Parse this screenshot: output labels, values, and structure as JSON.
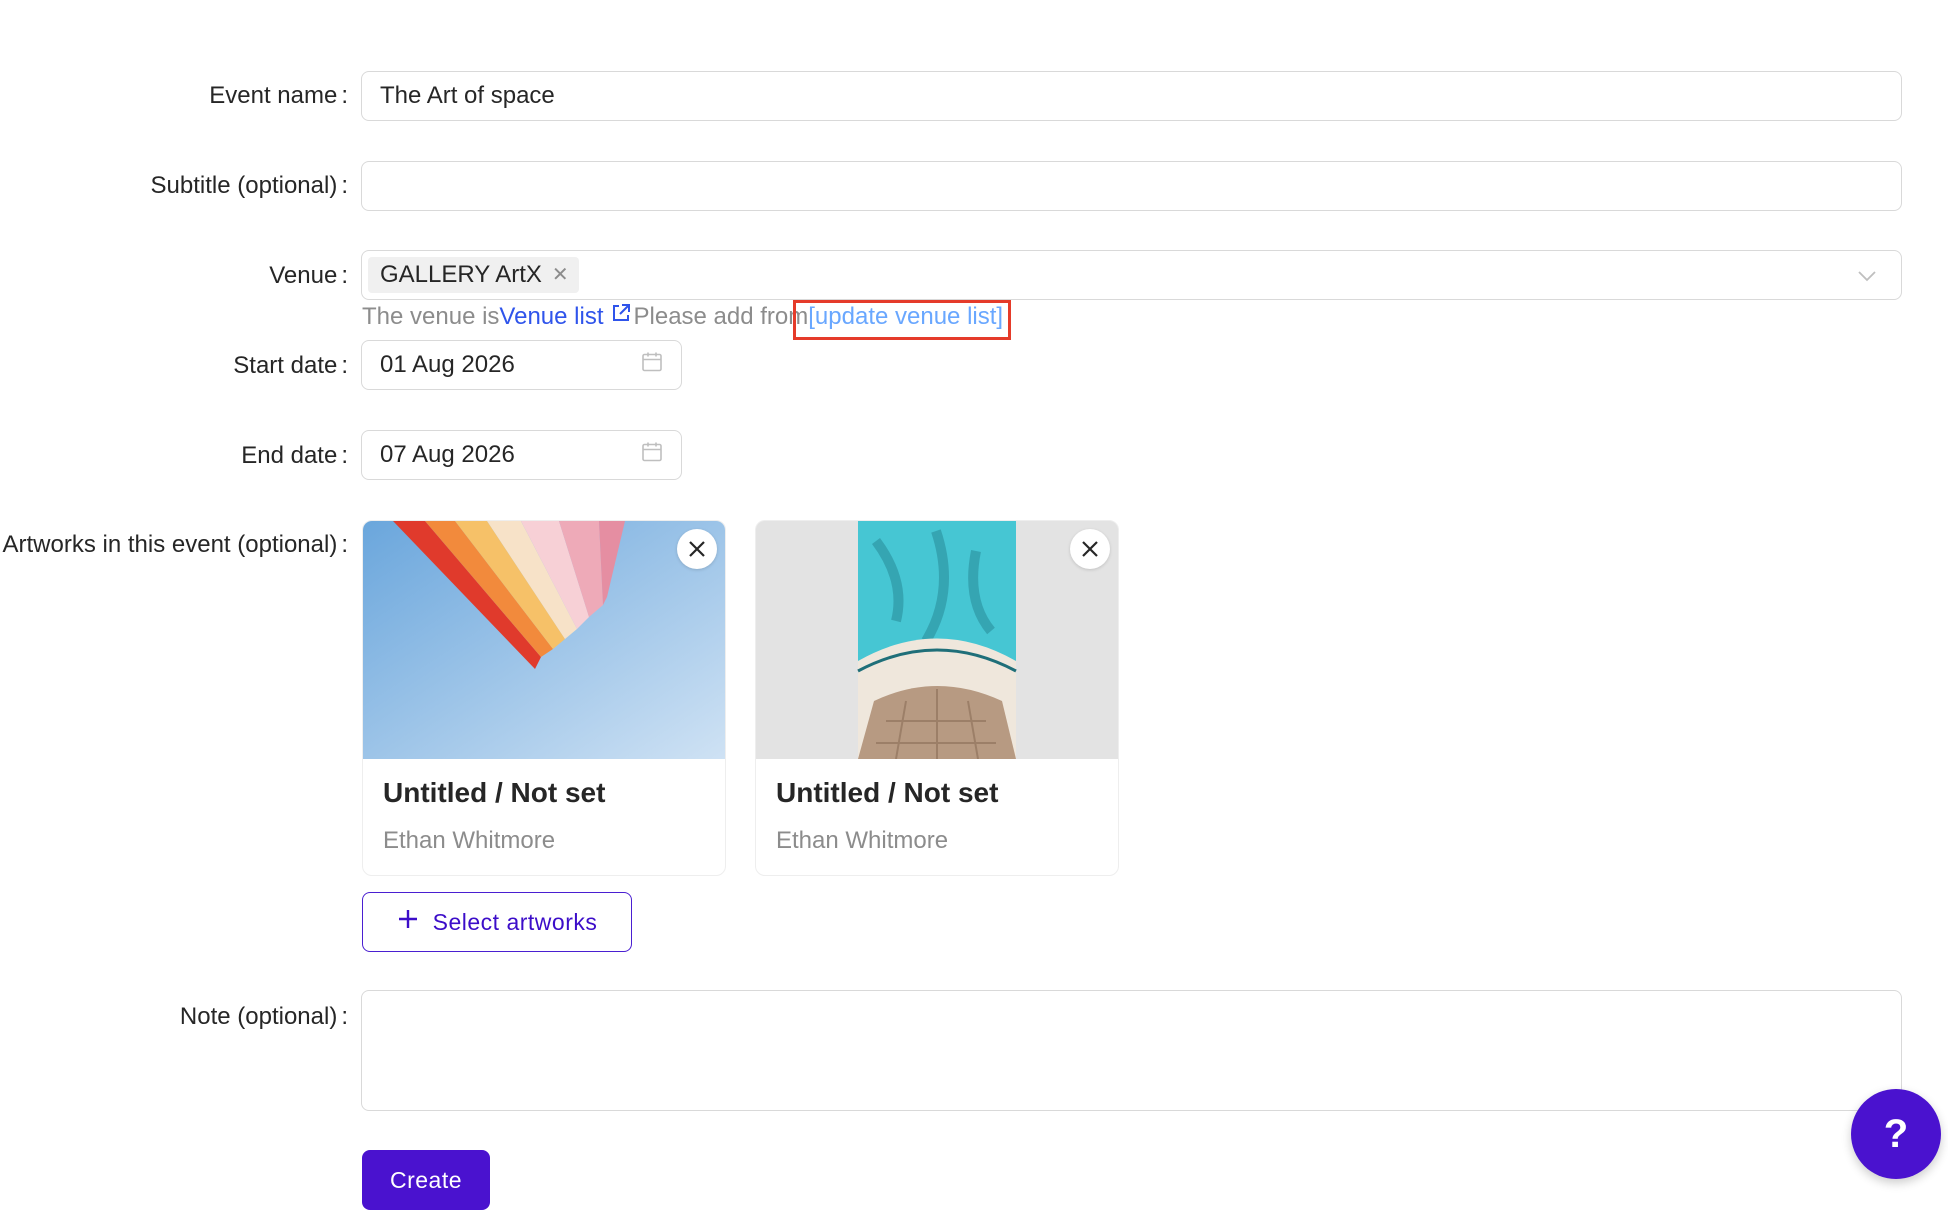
{
  "form": {
    "event_name": {
      "label": "Event name",
      "value": "The Art of space"
    },
    "subtitle": {
      "label": "Subtitle (optional)",
      "value": ""
    },
    "venue": {
      "label": "Venue",
      "selected_tag": "GALLERY ArtX",
      "help_prefix": "The venue is",
      "help_link": "Venue list",
      "help_middle": "Please add from",
      "help_update": "[update venue list]"
    },
    "start_date": {
      "label": "Start date",
      "value": "01 Aug 2026"
    },
    "end_date": {
      "label": "End date",
      "value": "07 Aug 2026"
    },
    "artworks": {
      "label": "Artworks in this event (optional)",
      "items": [
        {
          "title": "Untitled / Not set",
          "artist": "Ethan Whitmore"
        },
        {
          "title": "Untitled / Not set",
          "artist": "Ethan Whitmore"
        }
      ],
      "select_button": "Select artworks"
    },
    "note": {
      "label": "Note (optional)",
      "value": ""
    },
    "colon": ":",
    "create_button": "Create"
  },
  "help_fab": "?",
  "colors": {
    "primary": "#4a12cf",
    "link": "#2f54eb",
    "highlight_box": "#e53b2a"
  }
}
